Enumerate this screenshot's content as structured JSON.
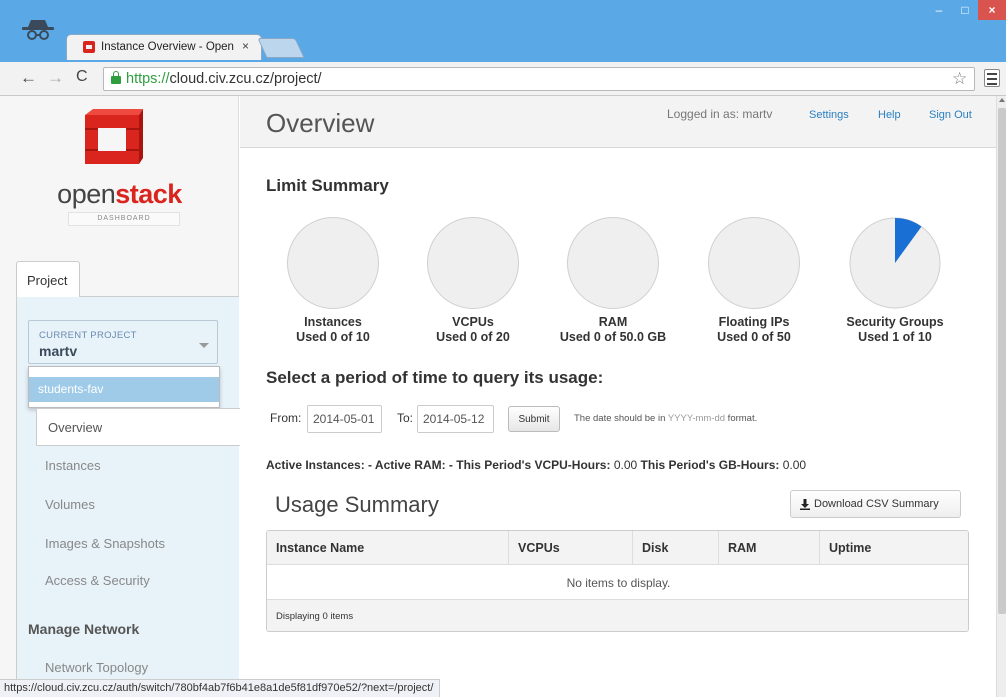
{
  "browser": {
    "tab_title": "Instance Overview - Open",
    "tab_close": "×",
    "url_scheme": "https://",
    "url_rest": "cloud.civ.zcu.cz/project/",
    "status_url": "https://cloud.civ.zcu.cz/auth/switch/780bf4ab7f6b41e8a1de5f81df970e52/?next=/project/",
    "controls": {
      "minimize": "–",
      "maximize": "□",
      "close": "×"
    },
    "nav": {
      "back": "←",
      "forward": "→",
      "reload": "C",
      "star": "☆"
    }
  },
  "sidebar": {
    "logo_text_plain": "open",
    "logo_text_accent": "stack",
    "logo_sub": "DASHBOARD",
    "tab": "Project",
    "current_project_caption": "CURRENT PROJECT",
    "current_project": "martv",
    "dropdown_option": "students-fav",
    "nav_items": [
      "Overview",
      "Instances",
      "Volumes",
      "Images & Snapshots",
      "Access & Security"
    ],
    "section_title": "Manage Network",
    "section_items": [
      "Network Topology"
    ]
  },
  "header": {
    "title": "Overview",
    "logged_in": "Logged in as: martv",
    "links": [
      "Settings",
      "Help",
      "Sign Out"
    ]
  },
  "limits": {
    "title": "Limit Summary",
    "items": [
      {
        "name": "Instances",
        "usage": "Used 0 of 10",
        "used": 0,
        "total": 10
      },
      {
        "name": "VCPUs",
        "usage": "Used 0 of 20",
        "used": 0,
        "total": 20
      },
      {
        "name": "RAM",
        "usage": "Used 0 of 50.0 GB",
        "used": 0,
        "total": 50
      },
      {
        "name": "Floating IPs",
        "usage": "Used 0 of 50",
        "used": 0,
        "total": 50
      },
      {
        "name": "Security Groups",
        "usage": "Used 1 of 10",
        "used": 1,
        "total": 10
      }
    ],
    "fill_color": "#1a6fd4"
  },
  "period": {
    "title": "Select a period of time to query its usage:",
    "from_label": "From:",
    "from_value": "2014-05-01",
    "to_label": "To:",
    "to_value": "2014-05-12",
    "submit": "Submit",
    "hint_prefix": "The date should be in ",
    "hint_format": "YYYY-mm-dd",
    "hint_suffix": " format."
  },
  "active": {
    "part1": "Active Instances: - Active RAM: - This Period's VCPU-Hours:",
    "vcpu_hours": "0.00",
    "part2": "This Period's GB-Hours:",
    "gb_hours": "0.00"
  },
  "usage": {
    "title": "Usage Summary",
    "download": "Download CSV Summary",
    "columns": [
      "Instance Name",
      "VCPUs",
      "Disk",
      "RAM",
      "Uptime"
    ],
    "empty": "No items to display.",
    "footer": "Displaying 0 items"
  }
}
